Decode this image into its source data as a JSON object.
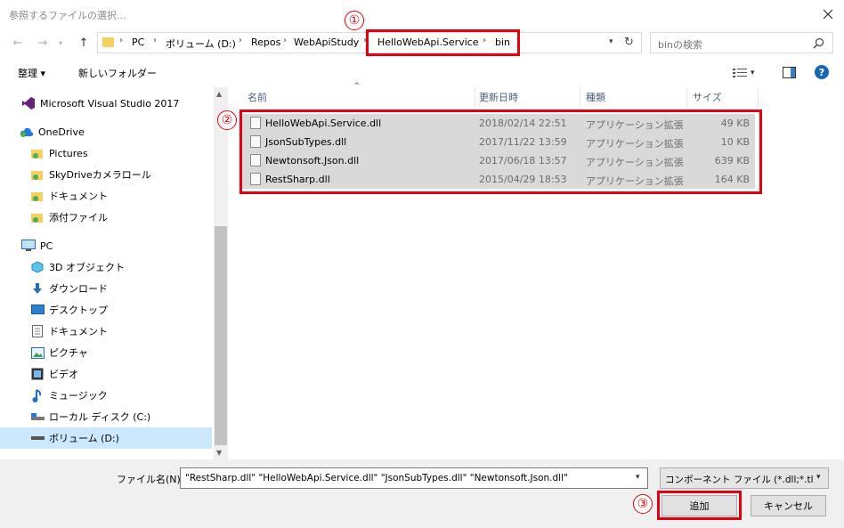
{
  "window": {
    "title": "参照するファイルの選択..."
  },
  "address": {
    "crumbs": [
      "PC",
      "ボリューム (D:)",
      "Repos",
      "WebApiStudy",
      "HelloWebApi.Service",
      "bin"
    ]
  },
  "search": {
    "placeholder": "binの検索"
  },
  "toolbar": {
    "organize": "整理 ▾",
    "new_folder": "新しいフォルダー"
  },
  "sidebar": {
    "items": [
      {
        "label": "Microsoft Visual Studio 2017",
        "icon": "visual-studio-icon"
      },
      {
        "label": "OneDrive",
        "icon": "cloud-icon"
      },
      {
        "label": "Pictures",
        "icon": "folder-icon"
      },
      {
        "label": "SkyDriveカメラロール",
        "icon": "folder-icon"
      },
      {
        "label": "ドキュメント",
        "icon": "folder-icon"
      },
      {
        "label": "添付ファイル",
        "icon": "folder-icon"
      },
      {
        "label": "PC",
        "icon": "computer-icon"
      },
      {
        "label": "3D オブジェクト",
        "icon": "cube-icon"
      },
      {
        "label": "ダウンロード",
        "icon": "download-icon"
      },
      {
        "label": "デスクトップ",
        "icon": "desktop-icon"
      },
      {
        "label": "ドキュメント",
        "icon": "document-icon"
      },
      {
        "label": "ピクチャ",
        "icon": "picture-icon"
      },
      {
        "label": "ビデオ",
        "icon": "video-icon"
      },
      {
        "label": "ミュージック",
        "icon": "music-icon"
      },
      {
        "label": "ローカル ディスク (C:)",
        "icon": "drive-icon"
      },
      {
        "label": "ボリューム (D:)",
        "icon": "drive-icon"
      }
    ]
  },
  "columns": {
    "name": "名前",
    "date": "更新日時",
    "type": "種類",
    "size": "サイズ"
  },
  "files": [
    {
      "name": "HelloWebApi.Service.dll",
      "date": "2018/02/14 22:51",
      "type": "アプリケーション拡張",
      "size": "49 KB"
    },
    {
      "name": "JsonSubTypes.dll",
      "date": "2017/11/22 13:59",
      "type": "アプリケーション拡張",
      "size": "10 KB"
    },
    {
      "name": "Newtonsoft.Json.dll",
      "date": "2017/06/18 13:57",
      "type": "アプリケーション拡張",
      "size": "639 KB"
    },
    {
      "name": "RestSharp.dll",
      "date": "2015/04/29 18:53",
      "type": "アプリケーション拡張",
      "size": "164 KB"
    }
  ],
  "annotations": {
    "one": "①",
    "two": "②",
    "three": "③"
  },
  "footer": {
    "filename_label": "ファイル名(N):",
    "filename_value": "\"RestSharp.dll\" \"HelloWebApi.Service.dll\" \"JsonSubTypes.dll\" \"Newtonsoft.Json.dll\"",
    "filter": "コンポーネント ファイル (*.dll;*.tlb;*.",
    "add_button": "追加",
    "cancel_button": "キャンセル"
  },
  "colors": {
    "highlight_red": "#e5000f",
    "selected_row": "#d9d9d9",
    "sidebar_selected": "#cce8ff",
    "folder_yellow": "#f5cf5f",
    "help_blue": "#1a64b4"
  }
}
